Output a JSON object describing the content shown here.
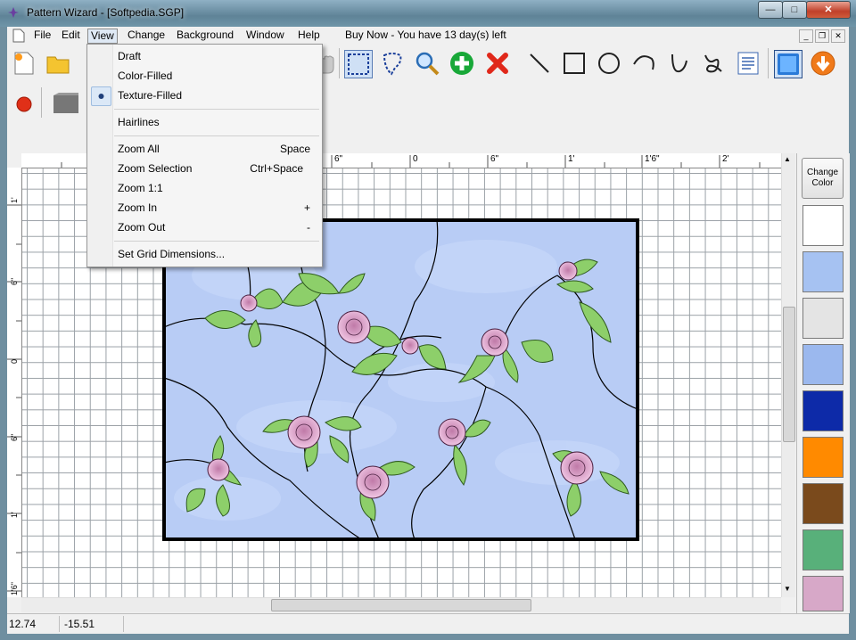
{
  "window": {
    "title": "Pattern Wizard - [Softpedia.SGP]"
  },
  "menubar": {
    "items": [
      "File",
      "Edit",
      "View",
      "Change",
      "Background",
      "Window",
      "Help"
    ],
    "trial_notice": "Buy Now - You have 13 day(s) left"
  },
  "view_menu": {
    "items": [
      {
        "label": "Draft",
        "shortcut": ""
      },
      {
        "label": "Color-Filled",
        "shortcut": ""
      },
      {
        "label": "Texture-Filled",
        "shortcut": "",
        "selected": true
      },
      {
        "label": "Hairlines",
        "shortcut": ""
      },
      {
        "label": "Zoom All",
        "shortcut": "Space"
      },
      {
        "label": "Zoom Selection",
        "shortcut": "Ctrl+Space"
      },
      {
        "label": "Zoom 1:1",
        "shortcut": ""
      },
      {
        "label": "Zoom In",
        "shortcut": "+"
      },
      {
        "label": "Zoom Out",
        "shortcut": "-"
      },
      {
        "label": "Set Grid Dimensions...",
        "shortcut": ""
      }
    ]
  },
  "rulers": {
    "horizontal": [
      "6\"",
      "0",
      "6\"",
      "1'",
      "1'6\"",
      "2'"
    ],
    "vertical": [
      "1'",
      "6\"",
      "0",
      "6\"",
      "1'",
      "1'6\""
    ]
  },
  "palette": {
    "change_label": "Change Color",
    "swatch_colors": [
      "#ffffff",
      "#a6c2f2",
      "#e4e4e4",
      "#9bb8ee",
      "#0d2aa8",
      "#ff8a00",
      "#7a4a1c",
      "#58b07a",
      "#d7a8c8"
    ]
  },
  "statusbar": {
    "x": "12.74",
    "y": "-15.51"
  },
  "colors": {
    "glass_blue": "#b8ccf5",
    "leaf_green": "#8dcf6a",
    "rose_pink": "#e8b3d6",
    "lead_line": "#000000"
  }
}
